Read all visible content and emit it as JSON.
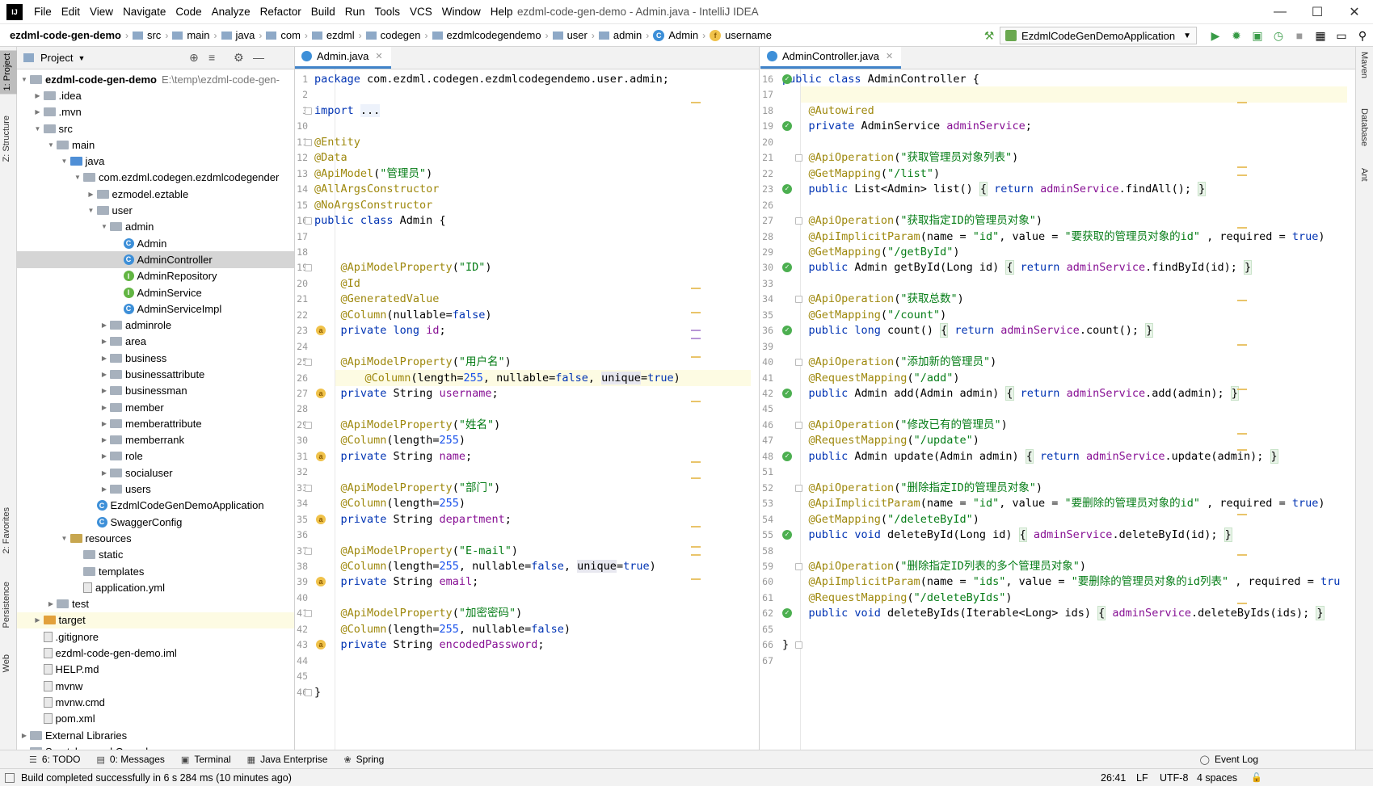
{
  "app": {
    "icon_text": "IJ",
    "window_title": "ezdml-code-gen-demo - Admin.java - IntelliJ IDEA",
    "menu": [
      "File",
      "Edit",
      "View",
      "Navigate",
      "Code",
      "Analyze",
      "Refactor",
      "Build",
      "Run",
      "Tools",
      "VCS",
      "Window",
      "Help"
    ]
  },
  "breadcrumb": {
    "items": [
      "ezdml-code-gen-demo",
      "src",
      "main",
      "java",
      "com",
      "ezdml",
      "codegen",
      "ezdmlcodegendemo",
      "user",
      "admin",
      "Admin",
      "username"
    ],
    "run_config": "EzdmlCodeGenDemoApplication"
  },
  "left_strip": [
    "1: Project",
    "Z: Structure",
    "2: Favorites",
    "Persistence",
    "Web"
  ],
  "right_strip": [
    "Maven",
    "Database",
    "Ant"
  ],
  "project": {
    "title": "Project",
    "root_name": "ezdml-code-gen-demo",
    "root_path": "E:\\temp\\ezdml-code-gen-",
    "rows": [
      {
        "label": ".idea",
        "indent": 1,
        "arrow": "▶",
        "icon": "folder grey"
      },
      {
        "label": ".mvn",
        "indent": 1,
        "arrow": "▶",
        "icon": "folder grey"
      },
      {
        "label": "src",
        "indent": 1,
        "arrow": "▼",
        "icon": "folder grey"
      },
      {
        "label": "main",
        "indent": 2,
        "arrow": "▼",
        "icon": "folder grey"
      },
      {
        "label": "java",
        "indent": 3,
        "arrow": "▼",
        "icon": "folder src"
      },
      {
        "label": "com.ezdml.codegen.ezdmlcodegender",
        "indent": 4,
        "arrow": "▼",
        "icon": "folder grey"
      },
      {
        "label": "ezmodel.eztable",
        "indent": 5,
        "arrow": "▶",
        "icon": "folder grey"
      },
      {
        "label": "user",
        "indent": 5,
        "arrow": "▼",
        "icon": "folder grey"
      },
      {
        "label": "admin",
        "indent": 6,
        "arrow": "▼",
        "icon": "folder grey"
      },
      {
        "label": "Admin",
        "indent": 7,
        "arrow": "",
        "icon": "cls"
      },
      {
        "label": "AdminController",
        "indent": 7,
        "arrow": "",
        "icon": "cls",
        "selected": true
      },
      {
        "label": "AdminRepository",
        "indent": 7,
        "arrow": "",
        "icon": "iface"
      },
      {
        "label": "AdminService",
        "indent": 7,
        "arrow": "",
        "icon": "iface"
      },
      {
        "label": "AdminServiceImpl",
        "indent": 7,
        "arrow": "",
        "icon": "cls"
      },
      {
        "label": "adminrole",
        "indent": 6,
        "arrow": "▶",
        "icon": "folder grey"
      },
      {
        "label": "area",
        "indent": 6,
        "arrow": "▶",
        "icon": "folder grey"
      },
      {
        "label": "business",
        "indent": 6,
        "arrow": "▶",
        "icon": "folder grey"
      },
      {
        "label": "businessattribute",
        "indent": 6,
        "arrow": "▶",
        "icon": "folder grey"
      },
      {
        "label": "businessman",
        "indent": 6,
        "arrow": "▶",
        "icon": "folder grey"
      },
      {
        "label": "member",
        "indent": 6,
        "arrow": "▶",
        "icon": "folder grey"
      },
      {
        "label": "memberattribute",
        "indent": 6,
        "arrow": "▶",
        "icon": "folder grey"
      },
      {
        "label": "memberrank",
        "indent": 6,
        "arrow": "▶",
        "icon": "folder grey"
      },
      {
        "label": "role",
        "indent": 6,
        "arrow": "▶",
        "icon": "folder grey"
      },
      {
        "label": "socialuser",
        "indent": 6,
        "arrow": "▶",
        "icon": "folder grey"
      },
      {
        "label": "users",
        "indent": 6,
        "arrow": "▶",
        "icon": "folder grey"
      },
      {
        "label": "EzdmlCodeGenDemoApplication",
        "indent": 5,
        "arrow": "",
        "icon": "cls"
      },
      {
        "label": "SwaggerConfig",
        "indent": 5,
        "arrow": "",
        "icon": "cls"
      },
      {
        "label": "resources",
        "indent": 3,
        "arrow": "▼",
        "icon": "folder res"
      },
      {
        "label": "static",
        "indent": 4,
        "arrow": "",
        "icon": "folder grey"
      },
      {
        "label": "templates",
        "indent": 4,
        "arrow": "",
        "icon": "folder grey"
      },
      {
        "label": "application.yml",
        "indent": 4,
        "arrow": "",
        "icon": "file"
      },
      {
        "label": "test",
        "indent": 2,
        "arrow": "▶",
        "icon": "folder grey"
      },
      {
        "label": "target",
        "indent": 1,
        "arrow": "▶",
        "icon": "folder orange",
        "hl": true
      },
      {
        "label": ".gitignore",
        "indent": 1,
        "arrow": "",
        "icon": "file"
      },
      {
        "label": "ezdml-code-gen-demo.iml",
        "indent": 1,
        "arrow": "",
        "icon": "file"
      },
      {
        "label": "HELP.md",
        "indent": 1,
        "arrow": "",
        "icon": "file"
      },
      {
        "label": "mvnw",
        "indent": 1,
        "arrow": "",
        "icon": "file"
      },
      {
        "label": "mvnw.cmd",
        "indent": 1,
        "arrow": "",
        "icon": "file"
      },
      {
        "label": "pom.xml",
        "indent": 1,
        "arrow": "",
        "icon": "file"
      },
      {
        "label": "External Libraries",
        "indent": 0,
        "arrow": "▶",
        "icon": "folder grey"
      },
      {
        "label": "Scratches and Consoles",
        "indent": 0,
        "arrow": "",
        "icon": "folder grey"
      }
    ]
  },
  "editor_left": {
    "tab": "Admin.java",
    "lines": [
      {
        "n": "1",
        "h": "<span class=\"kw\">package</span> com.ezdml.codegen.ezdmlcodegendemo.user.admin;"
      },
      {
        "n": "2",
        "h": ""
      },
      {
        "n": "3",
        "h": "<span class=\"kw\">import</span> <span class=\"bx\">...</span>"
      },
      {
        "n": "10",
        "h": ""
      },
      {
        "n": "11",
        "h": "<span class=\"an\">@Entity</span>"
      },
      {
        "n": "12",
        "h": "<span class=\"an\">@Data</span>"
      },
      {
        "n": "13",
        "h": "<span class=\"an\">@ApiModel</span>(<span class=\"st\">\"管理员\"</span>)"
      },
      {
        "n": "14",
        "h": "<span class=\"an\">@AllArgsConstructor</span>"
      },
      {
        "n": "15",
        "h": "<span class=\"an\">@NoArgsConstructor</span>"
      },
      {
        "n": "16",
        "h": "<span class=\"kw\">public class</span> Admin {"
      },
      {
        "n": "17",
        "h": ""
      },
      {
        "n": "18",
        "h": ""
      },
      {
        "n": "19",
        "h": "    <span class=\"an\">@ApiModelProperty</span>(<span class=\"st\">\"ID\"</span>)"
      },
      {
        "n": "20",
        "h": "    <span class=\"an\">@Id</span>"
      },
      {
        "n": "21",
        "h": "    <span class=\"an\">@GeneratedValue</span>"
      },
      {
        "n": "22",
        "h": "    <span class=\"an\">@Column</span>(nullable=<span class=\"kw\">false</span>)"
      },
      {
        "n": "23",
        "h": "    <span class=\"kw\">private long</span> <span class=\"fld\">id</span>;"
      },
      {
        "n": "24",
        "h": ""
      },
      {
        "n": "25",
        "h": "    <span class=\"an\">@ApiModelProperty</span>(<span class=\"st\">\"用户名\"</span>)"
      },
      {
        "n": "26",
        "h": "    <span class=\"an\">@Column</span>(length=<span class=\"num\">255</span>, nullable=<span class=\"kw\">false</span>, <span class=\"und\">unique</span>=<span class=\"kw\">true</span>)"
      },
      {
        "n": "27",
        "h": "    <span class=\"kw\">private</span> String <span class=\"fld\">username</span>;"
      },
      {
        "n": "28",
        "h": ""
      },
      {
        "n": "29",
        "h": "    <span class=\"an\">@ApiModelProperty</span>(<span class=\"st\">\"姓名\"</span>)"
      },
      {
        "n": "30",
        "h": "    <span class=\"an\">@Column</span>(length=<span class=\"num\">255</span>)"
      },
      {
        "n": "31",
        "h": "    <span class=\"kw\">private</span> String <span class=\"fld\">name</span>;"
      },
      {
        "n": "32",
        "h": ""
      },
      {
        "n": "33",
        "h": "    <span class=\"an\">@ApiModelProperty</span>(<span class=\"st\">\"部门\"</span>)"
      },
      {
        "n": "34",
        "h": "    <span class=\"an\">@Column</span>(length=<span class=\"num\">255</span>)"
      },
      {
        "n": "35",
        "h": "    <span class=\"kw\">private</span> String <span class=\"fld\">department</span>;"
      },
      {
        "n": "36",
        "h": ""
      },
      {
        "n": "37",
        "h": "    <span class=\"an\">@ApiModelProperty</span>(<span class=\"st\">\"E-mail\"</span>)"
      },
      {
        "n": "38",
        "h": "    <span class=\"an\">@Column</span>(length=<span class=\"num\">255</span>, nullable=<span class=\"kw\">false</span>, <span class=\"und\">unique</span>=<span class=\"kw\">true</span>)"
      },
      {
        "n": "39",
        "h": "    <span class=\"kw\">private</span> String <span class=\"fld\">email</span>;"
      },
      {
        "n": "40",
        "h": ""
      },
      {
        "n": "41",
        "h": "    <span class=\"an\">@ApiModelProperty</span>(<span class=\"st\">\"加密密码\"</span>)"
      },
      {
        "n": "42",
        "h": "    <span class=\"an\">@Column</span>(length=<span class=\"num\">255</span>, nullable=<span class=\"kw\">false</span>)"
      },
      {
        "n": "43",
        "h": "    <span class=\"kw\">private</span> String <span class=\"fld\">encodedPassword</span>;"
      },
      {
        "n": "44",
        "h": ""
      },
      {
        "n": "45",
        "h": ""
      },
      {
        "n": "46",
        "h": "}"
      }
    ]
  },
  "editor_right": {
    "tab": "AdminController.java",
    "lines": [
      {
        "n": "16",
        "h": "<span class=\"kw\">public class</span> AdminController {"
      },
      {
        "n": "17",
        "h": ""
      },
      {
        "n": "18",
        "h": "    <span class=\"an\">@Autowired</span>"
      },
      {
        "n": "19",
        "h": "    <span class=\"kw\">private</span> AdminService <span class=\"fld\">adminService</span>;"
      },
      {
        "n": "20",
        "h": ""
      },
      {
        "n": "21",
        "h": "    <span class=\"an\">@ApiOperation</span>(<span class=\"st\">\"获取管理员对象列表\"</span>)"
      },
      {
        "n": "22",
        "h": "    <span class=\"an\">@GetMapping</span>(<span class=\"st\">\"/list\"</span>)"
      },
      {
        "n": "23",
        "h": "    <span class=\"kw\">public</span> List&lt;Admin&gt; list() <span class=\"brk\">{</span> <span class=\"kw\">return</span> <span class=\"fld\">adminService</span>.findAll(); <span class=\"brk\">}</span>"
      },
      {
        "n": "26",
        "h": ""
      },
      {
        "n": "27",
        "h": "    <span class=\"an\">@ApiOperation</span>(<span class=\"st\">\"获取指定ID的管理员对象\"</span>)"
      },
      {
        "n": "28",
        "h": "    <span class=\"an\">@ApiImplicitParam</span>(name = <span class=\"st\">\"id\"</span>, value = <span class=\"st\">\"要获取的管理员对象的id\"</span> , required = <span class=\"kw\">true</span>)"
      },
      {
        "n": "29",
        "h": "    <span class=\"an\">@GetMapping</span>(<span class=\"st\">\"/getById\"</span>)"
      },
      {
        "n": "30",
        "h": "    <span class=\"kw\">public</span> Admin getById(Long id) <span class=\"brk\">{</span> <span class=\"kw\">return</span> <span class=\"fld\">adminService</span>.findById(id); <span class=\"brk\">}</span>"
      },
      {
        "n": "33",
        "h": ""
      },
      {
        "n": "34",
        "h": "    <span class=\"an\">@ApiOperation</span>(<span class=\"st\">\"获取总数\"</span>)"
      },
      {
        "n": "35",
        "h": "    <span class=\"an\">@GetMapping</span>(<span class=\"st\">\"/count\"</span>)"
      },
      {
        "n": "36",
        "h": "    <span class=\"kw\">public long</span> count() <span class=\"brk\">{</span> <span class=\"kw\">return</span> <span class=\"fld\">adminService</span>.count(); <span class=\"brk\">}</span>"
      },
      {
        "n": "39",
        "h": ""
      },
      {
        "n": "40",
        "h": "    <span class=\"an\">@ApiOperation</span>(<span class=\"st\">\"添加新的管理员\"</span>)"
      },
      {
        "n": "41",
        "h": "    <span class=\"an\">@RequestMapping</span>(<span class=\"st\">\"/add\"</span>)"
      },
      {
        "n": "42",
        "h": "    <span class=\"kw\">public</span> Admin add(Admin admin) <span class=\"brk\">{</span> <span class=\"kw\">return</span> <span class=\"fld\">adminService</span>.add(admin); <span class=\"brk\">}</span>"
      },
      {
        "n": "45",
        "h": ""
      },
      {
        "n": "46",
        "h": "    <span class=\"an\">@ApiOperation</span>(<span class=\"st\">\"修改已有的管理员\"</span>)"
      },
      {
        "n": "47",
        "h": "    <span class=\"an\">@RequestMapping</span>(<span class=\"st\">\"/update\"</span>)"
      },
      {
        "n": "48",
        "h": "    <span class=\"kw\">public</span> Admin update(Admin admin) <span class=\"brk\">{</span> <span class=\"kw\">return</span> <span class=\"fld\">adminService</span>.update(admin); <span class=\"brk\">}</span>"
      },
      {
        "n": "51",
        "h": ""
      },
      {
        "n": "52",
        "h": "    <span class=\"an\">@ApiOperation</span>(<span class=\"st\">\"删除指定ID的管理员对象\"</span>)"
      },
      {
        "n": "53",
        "h": "    <span class=\"an\">@ApiImplicitParam</span>(name = <span class=\"st\">\"id\"</span>, value = <span class=\"st\">\"要删除的管理员对象的id\"</span> , required = <span class=\"kw\">true</span>)"
      },
      {
        "n": "54",
        "h": "    <span class=\"an\">@GetMapping</span>(<span class=\"st\">\"/deleteById\"</span>)"
      },
      {
        "n": "55",
        "h": "    <span class=\"kw\">public void</span> deleteById(Long id) <span class=\"brk\">{</span> <span class=\"fld\">adminService</span>.deleteById(id); <span class=\"brk\">}</span>"
      },
      {
        "n": "58",
        "h": ""
      },
      {
        "n": "59",
        "h": "    <span class=\"an\">@ApiOperation</span>(<span class=\"st\">\"删除指定ID列表的多个管理员对象\"</span>)"
      },
      {
        "n": "60",
        "h": "    <span class=\"an\">@ApiImplicitParam</span>(name = <span class=\"st\">\"ids\"</span>, value = <span class=\"st\">\"要删除的管理员对象的id列表\"</span> , required = <span class=\"kw\">tru</span>"
      },
      {
        "n": "61",
        "h": "    <span class=\"an\">@RequestMapping</span>(<span class=\"st\">\"/deleteByIds\"</span>)"
      },
      {
        "n": "62",
        "h": "    <span class=\"kw\">public void</span> deleteByIds(Iterable&lt;Long&gt; ids) <span class=\"brk\">{</span> <span class=\"fld\">adminService</span>.deleteByIds(ids); <span class=\"brk\">}</span>"
      },
      {
        "n": "65",
        "h": ""
      },
      {
        "n": "66",
        "h": "}"
      },
      {
        "n": "67",
        "h": ""
      }
    ]
  },
  "bottom_tools": [
    {
      "icon": "☰",
      "label": "6: TODO"
    },
    {
      "icon": "▤",
      "label": "0: Messages"
    },
    {
      "icon": "▣",
      "label": "Terminal"
    },
    {
      "icon": "▦",
      "label": "Java Enterprise"
    },
    {
      "icon": "❀",
      "label": "Spring"
    }
  ],
  "event_log": "Event Log",
  "status": {
    "message": "Build completed successfully in 6 s 284 ms (10 minutes ago)",
    "position": "26:41",
    "line_sep": "LF",
    "encoding": "UTF-8",
    "indent": "4 spaces"
  }
}
